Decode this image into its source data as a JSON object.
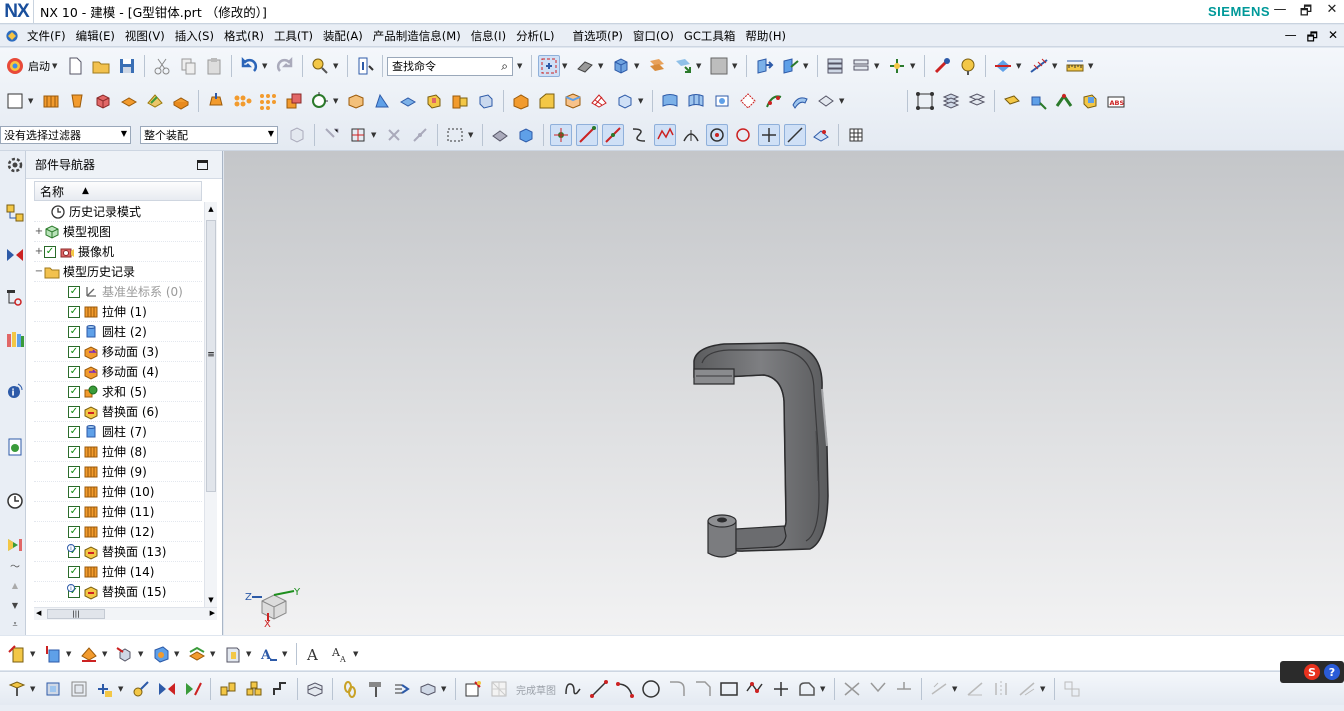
{
  "window": {
    "logo": "NX",
    "title": "NX 10 - 建模 - [G型钳体.prt （修改的）]",
    "brand": "SIEMENS",
    "controls": [
      "—",
      "🗗",
      "✕"
    ]
  },
  "menu": {
    "items": [
      "文件(F)",
      "编辑(E)",
      "视图(V)",
      "插入(S)",
      "格式(R)",
      "工具(T)",
      "装配(A)",
      "产品制造信息(M)",
      "信息(I)",
      "分析(L)",
      "首选项(P)",
      "窗口(O)",
      "GC工具箱",
      "帮助(H)"
    ],
    "right_controls": [
      "—",
      "🗗",
      "✕"
    ]
  },
  "toolbar": {
    "start_label": "启动",
    "find_command_label": "查找命令",
    "selection_filter_value": "没有选择过滤器",
    "assembly_scope_value": "整个装配"
  },
  "navigator": {
    "title": "部件导航器",
    "column_name": "名称",
    "sort_glyph": "▲",
    "rows": [
      {
        "label": "历史记录模式",
        "icon": "clock-icon",
        "checked": false,
        "indent": 1
      },
      {
        "label": "模型视图",
        "icon": "model-view-icon",
        "checked": false,
        "indent": 0,
        "expand": "+"
      },
      {
        "label": "摄像机",
        "icon": "camera-icon",
        "checked": true,
        "indent": 0,
        "expand": "+"
      },
      {
        "label": "模型历史记录",
        "icon": "folder-icon",
        "checked": false,
        "indent": 0,
        "expand": "−"
      },
      {
        "label": "基准坐标系 (0)",
        "icon": "datum-csys-icon",
        "checked": true,
        "indent": 2,
        "gray": true
      },
      {
        "label": "拉伸 (1)",
        "icon": "extrude-icon",
        "checked": true,
        "indent": 2
      },
      {
        "label": "圆柱 (2)",
        "icon": "cylinder-icon",
        "checked": true,
        "indent": 2
      },
      {
        "label": "移动面 (3)",
        "icon": "move-face-icon",
        "checked": true,
        "indent": 2
      },
      {
        "label": "移动面 (4)",
        "icon": "move-face-icon",
        "checked": true,
        "indent": 2
      },
      {
        "label": "求和 (5)",
        "icon": "unite-icon",
        "checked": true,
        "indent": 2
      },
      {
        "label": "替换面 (6)",
        "icon": "replace-face-icon",
        "checked": true,
        "indent": 2
      },
      {
        "label": "圆柱 (7)",
        "icon": "cylinder-icon",
        "checked": true,
        "indent": 2
      },
      {
        "label": "拉伸 (8)",
        "icon": "extrude-icon",
        "checked": true,
        "indent": 2
      },
      {
        "label": "拉伸 (9)",
        "icon": "extrude-icon",
        "checked": true,
        "indent": 2
      },
      {
        "label": "拉伸 (10)",
        "icon": "extrude-icon",
        "checked": true,
        "indent": 2
      },
      {
        "label": "拉伸 (11)",
        "icon": "extrude-icon",
        "checked": true,
        "indent": 2
      },
      {
        "label": "拉伸 (12)",
        "icon": "extrude-icon",
        "checked": true,
        "indent": 2
      },
      {
        "label": "替换面 (13)",
        "icon": "replace-face-icon",
        "checked": true,
        "indent": 2,
        "info": true
      },
      {
        "label": "拉伸 (14)",
        "icon": "extrude-icon",
        "checked": true,
        "indent": 2
      },
      {
        "label": "替换面 (15)",
        "icon": "replace-face-icon",
        "checked": true,
        "indent": 2,
        "info": true
      }
    ]
  },
  "graphics": {
    "axis_labels": {
      "x": "X",
      "y": "Y",
      "z": "Z"
    }
  },
  "sketch": {
    "finish_sketch_label": "完成草图"
  },
  "ime": {
    "s": "S",
    "q": "?"
  },
  "colors": {
    "brand_teal": "#009999",
    "nx_blue": "#1a4f9c",
    "check_green": "#0a8a0a",
    "model_gray": "#6e6e70"
  }
}
